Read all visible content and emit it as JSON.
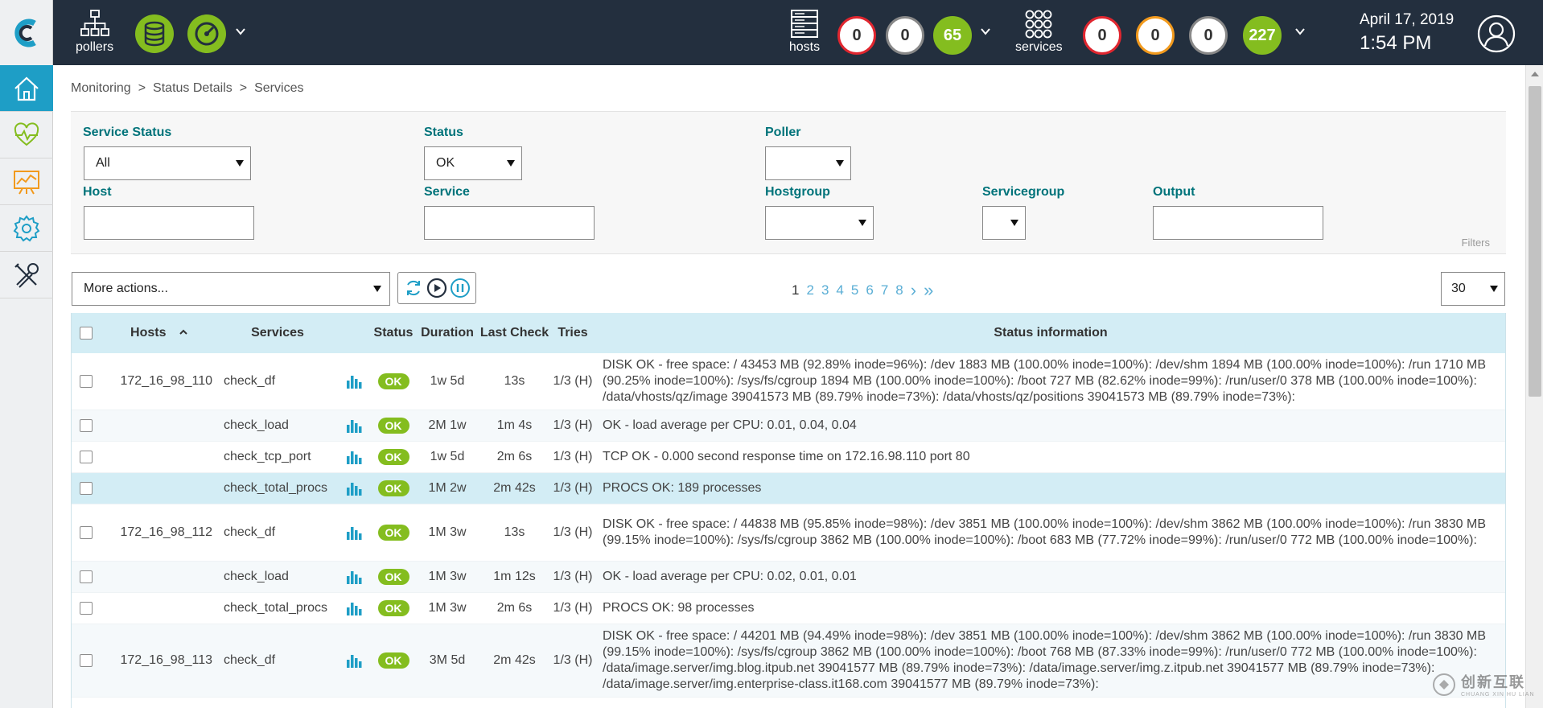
{
  "topbar": {
    "pollers_label": "pollers",
    "hosts_label": "hosts",
    "services_label": "services",
    "host_counts": [
      "0",
      "0",
      "65"
    ],
    "service_counts": [
      "0",
      "0",
      "0",
      "227"
    ],
    "date": "April 17, 2019",
    "time": "1:54 PM"
  },
  "colors": {
    "topbar": "#232f3e",
    "accent_teal": "#1e9ec6",
    "ok_green": "#84bd1f",
    "critical_red": "#e0262f",
    "warning_orange": "#f29a1d"
  },
  "nav": {
    "items": [
      "home-icon",
      "monitoring-heartbeat-icon",
      "reporting-chart-icon",
      "configuration-gear-icon",
      "administration-tools-icon"
    ]
  },
  "breadcrumb": {
    "items": [
      "Monitoring",
      "Status Details",
      "Services"
    ],
    "separator": ">"
  },
  "filters": {
    "service_status_label": "Service Status",
    "service_status_value": "All",
    "status_label": "Status",
    "status_value": "OK",
    "poller_label": "Poller",
    "poller_value": "",
    "host_label": "Host",
    "service_label": "Service",
    "hostgroup_label": "Hostgroup",
    "servicegroup_label": "Servicegroup",
    "output_label": "Output",
    "filters_tag": "Filters"
  },
  "actions": {
    "more_actions": "More actions...",
    "per_page": "30"
  },
  "pagination": {
    "pages": [
      "1",
      "2",
      "3",
      "4",
      "5",
      "6",
      "7",
      "8"
    ],
    "current": "1",
    "next": "›",
    "last": "»"
  },
  "table": {
    "headers": {
      "hosts": "Hosts",
      "services": "Services",
      "status": "Status",
      "duration": "Duration",
      "last_check": "Last Check",
      "tries": "Tries",
      "status_information": "Status information"
    },
    "rows": [
      {
        "host": "172_16_98_110",
        "service": "check_df",
        "status": "OK",
        "duration": "1w 5d",
        "last_check": "13s",
        "tries": "1/3 (H)",
        "info": "DISK OK - free space: / 43453 MB (92.89% inode=96%): /dev 1883 MB (100.00% inode=100%): /dev/shm 1894 MB (100.00% inode=100%): /run 1710 MB (90.25% inode=100%): /sys/fs/cgroup 1894 MB (100.00% inode=100%): /boot 727 MB (82.62% inode=99%): /run/user/0 378 MB (100.00% inode=100%): /data/vhosts/qz/image 39041573 MB (89.79% inode=73%): /data/vhosts/qz/positions 39041573 MB (89.79% inode=73%):"
      },
      {
        "host": "",
        "service": "check_load",
        "status": "OK",
        "duration": "2M 1w",
        "last_check": "1m 4s",
        "tries": "1/3 (H)",
        "info": "OK - load average per CPU: 0.01, 0.04, 0.04"
      },
      {
        "host": "",
        "service": "check_tcp_port",
        "status": "OK",
        "duration": "1w 5d",
        "last_check": "2m 6s",
        "tries": "1/3 (H)",
        "info": "TCP OK - 0.000 second response time on 172.16.98.110 port 80"
      },
      {
        "host": "",
        "service": "check_total_procs",
        "status": "OK",
        "duration": "1M 2w",
        "last_check": "2m 42s",
        "tries": "1/3 (H)",
        "info": "PROCS OK: 189 processes"
      },
      {
        "host": "172_16_98_112",
        "service": "check_df",
        "status": "OK",
        "duration": "1M 3w",
        "last_check": "13s",
        "tries": "1/3 (H)",
        "info": "DISK OK - free space: / 44838 MB (95.85% inode=98%): /dev 3851 MB (100.00% inode=100%): /dev/shm 3862 MB (100.00% inode=100%): /run 3830 MB (99.15% inode=100%): /sys/fs/cgroup 3862 MB (100.00% inode=100%): /boot 683 MB (77.72% inode=99%): /run/user/0 772 MB (100.00% inode=100%):"
      },
      {
        "host": "",
        "service": "check_load",
        "status": "OK",
        "duration": "1M 3w",
        "last_check": "1m 12s",
        "tries": "1/3 (H)",
        "info": "OK - load average per CPU: 0.02, 0.01, 0.01"
      },
      {
        "host": "",
        "service": "check_total_procs",
        "status": "OK",
        "duration": "1M 3w",
        "last_check": "2m 6s",
        "tries": "1/3 (H)",
        "info": "PROCS OK: 98 processes"
      },
      {
        "host": "172_16_98_113",
        "service": "check_df",
        "status": "OK",
        "duration": "3M 5d",
        "last_check": "2m 42s",
        "tries": "1/3 (H)",
        "info": "DISK OK - free space: / 44201 MB (94.49% inode=98%): /dev 3851 MB (100.00% inode=100%): /dev/shm 3862 MB (100.00% inode=100%): /run 3830 MB (99.15% inode=100%): /sys/fs/cgroup 3862 MB (100.00% inode=100%): /boot 768 MB (87.33% inode=99%): /run/user/0 772 MB (100.00% inode=100%): /data/image.server/img.blog.itpub.net 39041577 MB (89.79% inode=73%): /data/image.server/img.z.itpub.net 39041577 MB (89.79% inode=73%): /data/image.server/img.enterprise-class.it168.com 39041577 MB (89.79% inode=73%):"
      }
    ]
  },
  "watermark": {
    "text": "创新互联",
    "sub": "CHUANG XIN HU LIAN"
  }
}
